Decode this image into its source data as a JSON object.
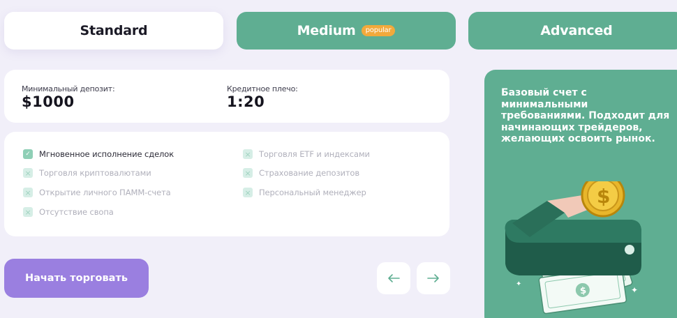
{
  "tabs": [
    {
      "label": "Standard"
    },
    {
      "label": "Medium",
      "badge": "popular"
    },
    {
      "label": "Advanced"
    }
  ],
  "stats": {
    "min_deposit_label": "Минимальный депозит:",
    "min_deposit_value": "$1000",
    "leverage_label": "Кредитное плечо:",
    "leverage_value": "1:20"
  },
  "features": [
    {
      "label": "Мгновенное исполнение сделок",
      "enabled": true
    },
    {
      "label": "Торговля криптовалютами",
      "enabled": false
    },
    {
      "label": "Открытие личного ПАММ-счета",
      "enabled": false
    },
    {
      "label": "Отсутствие свопа",
      "enabled": false
    },
    {
      "label": "Торговля ETF и индексами",
      "enabled": false
    },
    {
      "label": "Страхование депозитов",
      "enabled": false
    },
    {
      "label": "Персональный менеджер",
      "enabled": false
    }
  ],
  "actions": {
    "start_trading": "Начать торговать",
    "prev_icon": "arrow-left-icon",
    "next_icon": "arrow-right-icon"
  },
  "promo": {
    "text": "Базовый счет с минимальными требованиями. Подходит для начинающих трейдеров, желающих освоить рынок.",
    "illustration": "wallet-coin-illustration"
  },
  "colors": {
    "background": "#f1eff9",
    "accent_green": "#5fae92",
    "accent_purple": "#9a7fe0",
    "badge_orange": "#f2a93b"
  }
}
